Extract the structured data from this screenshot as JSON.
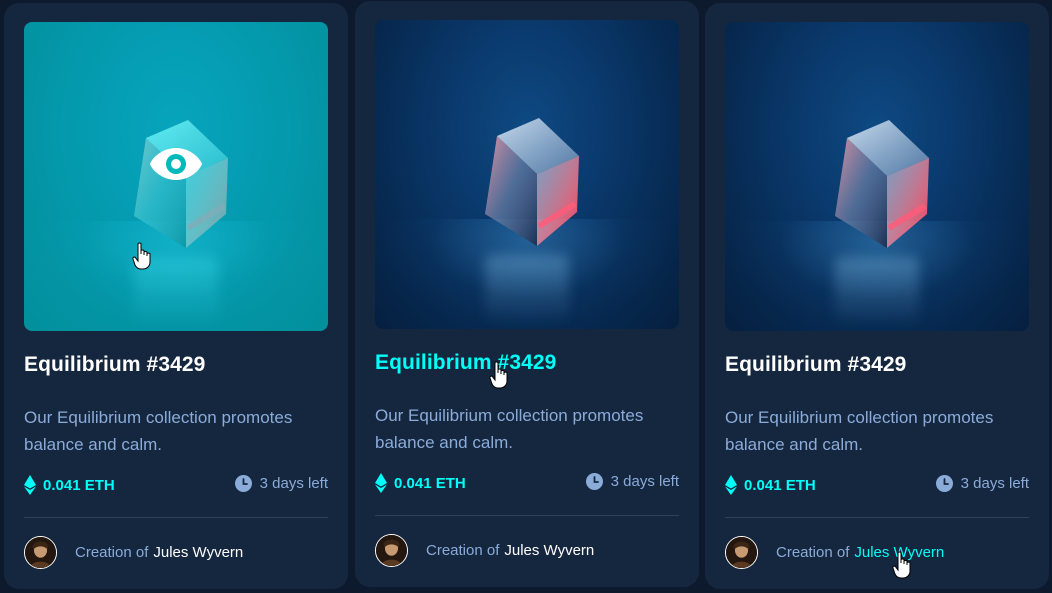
{
  "cards": [
    {
      "title": "Equilibrium #3429",
      "description": "Our Equilibrium collection promotes balance and calm.",
      "price": "0.041 ETH",
      "time_left": "3 days left",
      "creator_prefix": "Creation of",
      "creator_name": "Jules Wyvern",
      "state": "image-hover"
    },
    {
      "title": "Equilibrium #3429",
      "description": "Our Equilibrium collection promotes balance and calm.",
      "price": "0.041 ETH",
      "time_left": "3 days left",
      "creator_prefix": "Creation of",
      "creator_name": "Jules Wyvern",
      "state": "title-hover"
    },
    {
      "title": "Equilibrium #3429",
      "description": "Our Equilibrium collection promotes balance and calm.",
      "price": "0.041 ETH",
      "time_left": "3 days left",
      "creator_prefix": "Creation of",
      "creator_name": "Jules Wyvern",
      "state": "creator-hover"
    }
  ],
  "icons": {
    "price": "ethereum-icon",
    "time": "clock-icon",
    "overlay": "eye-icon",
    "pointer": "hand-pointer-icon"
  },
  "colors": {
    "page_background": "#0d192c",
    "card_background": "#15263f",
    "accent_cyan": "#00fff8",
    "soft_blue": "#8bacd9",
    "white": "#ffffff",
    "divider": "#2e405a"
  }
}
